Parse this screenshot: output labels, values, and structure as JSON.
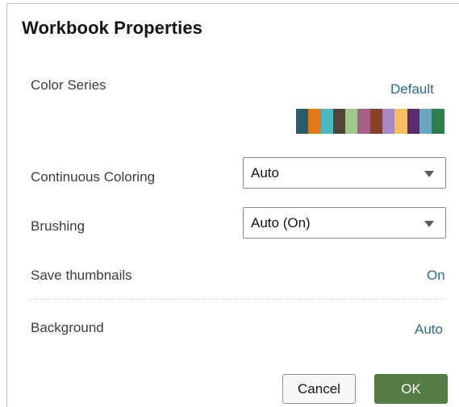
{
  "dialog": {
    "title": "Workbook Properties"
  },
  "color_series": {
    "label": "Color Series",
    "value": "Default",
    "swatches": [
      "#2b5c6b",
      "#e07b1a",
      "#4db8bf",
      "#52443b",
      "#9fc98a",
      "#a85f84",
      "#8a4226",
      "#a987c4",
      "#f5bf63",
      "#5a2e6e",
      "#6aa6bf",
      "#2f7d4a"
    ]
  },
  "continuous_coloring": {
    "label": "Continuous Coloring",
    "value": "Auto"
  },
  "brushing": {
    "label": "Brushing",
    "value": "Auto (On)"
  },
  "save_thumbnails": {
    "label": "Save thumbnails",
    "value": "On"
  },
  "background": {
    "label": "Background",
    "value": "Auto"
  },
  "buttons": {
    "cancel": "Cancel",
    "ok": "OK"
  },
  "colors": {
    "link": "#2a6c8c",
    "ok_button": "#557c45",
    "title": "#161513"
  }
}
